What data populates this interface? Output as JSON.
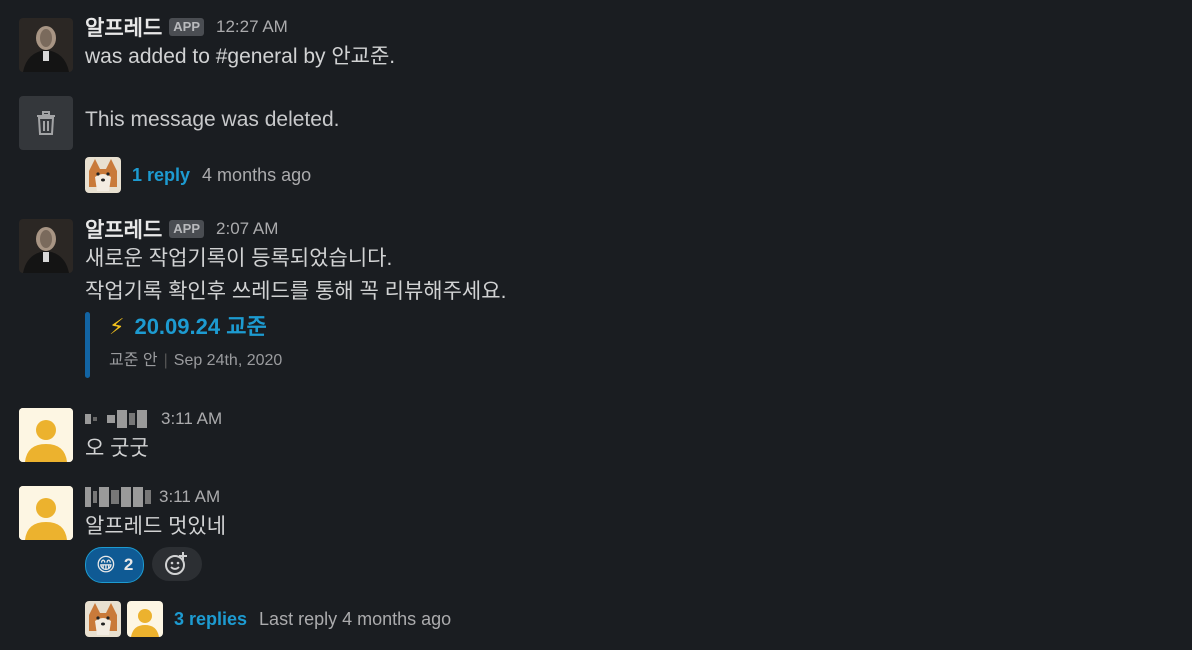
{
  "messages": [
    {
      "sender": "알프레드",
      "badge": "APP",
      "time": "12:27 AM",
      "text": "was added to #general by 안교준."
    },
    {
      "deleted_text": "This message was deleted.",
      "thread": {
        "replies": "1 reply",
        "meta": "4 months ago"
      }
    },
    {
      "sender": "알프레드",
      "badge": "APP",
      "time": "2:07 AM",
      "lines": [
        "새로운 작업기록이 등록되었습니다.",
        "작업기록 확인후 쓰레드를 통해 꼭 리뷰해주세요."
      ],
      "attachment": {
        "icon": "⚡",
        "title": "20.09.24 교준",
        "author": "교준 안",
        "date": "Sep 24th, 2020"
      }
    },
    {
      "time": "3:11 AM",
      "text": "오 굿굿"
    },
    {
      "time": "3:11 AM",
      "text": "알프레드 멋있네",
      "reaction": {
        "emoji": "😁",
        "count": "2"
      },
      "thread": {
        "replies": "3 replies",
        "meta": "Last reply 4 months ago"
      }
    }
  ],
  "colors": {
    "background": "#1a1d21",
    "link": "#1d9bd1",
    "attachment_bar": "#1264a3",
    "default_avatar_bg": "#fdf6e3",
    "default_avatar_fg": "#ecb22e"
  }
}
